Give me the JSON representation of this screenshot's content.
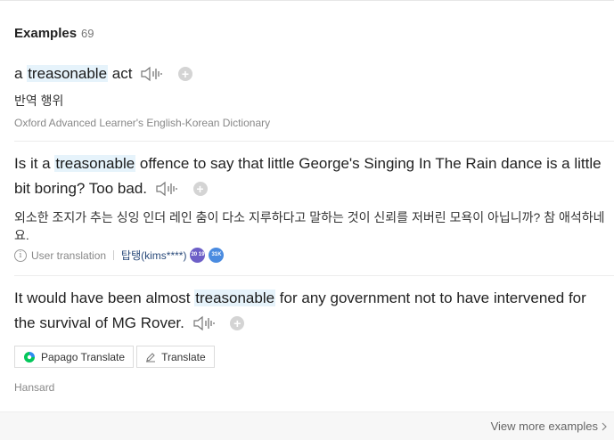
{
  "header": {
    "title": "Examples",
    "count": "69"
  },
  "examples": [
    {
      "pre": "a ",
      "highlight": "treasonable",
      "post": " act",
      "translation": "반역 행위",
      "source": "Oxford Advanced Learner's English-Korean Dictionary"
    },
    {
      "pre": "Is it a ",
      "highlight": "treasonable",
      "post": " offence to say that little George's Singing In The Rain dance is a little bit boring? Too bad.",
      "translation": "외소한 조지가 추는 싱잉 인더 레인 춤이 다소 지루하다고 말하는 것이 신뢰를 저버린 모욕이 아닙니까? 참 애석하네요.",
      "meta": {
        "label": "User translation",
        "user": "탑탱(kims****)",
        "badge_1": "20 19",
        "badge_2": "31K"
      }
    },
    {
      "pre": "It would have been almost ",
      "highlight": "treasonable",
      "post": " for any government not to have intervened for the survival of MG Rover.",
      "buttons": {
        "papago": "Papago Translate",
        "translate": "Translate"
      },
      "source": "Hansard"
    }
  ],
  "footer": {
    "more": "View more examples"
  },
  "colors": {
    "highlight": "#e6f3fb",
    "papago_green": "#03c75a",
    "papago_blue": "#2d8cf0",
    "badge_purple": "#6d5fc7",
    "badge_blue": "#4a8be0"
  },
  "icons": [
    "speaker-icon",
    "add-icon",
    "info-icon",
    "papago-icon",
    "pencil-icon",
    "chevron-right-icon"
  ]
}
